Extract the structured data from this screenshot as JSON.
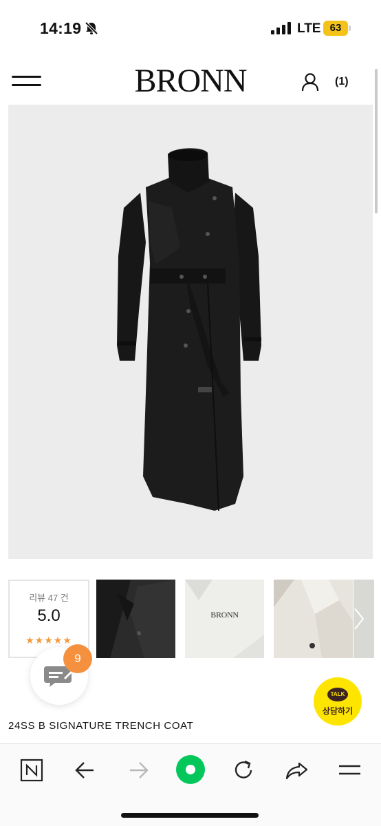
{
  "status_bar": {
    "time": "14:19",
    "network": "LTE",
    "battery": "63",
    "icons": [
      "bell-slash-icon",
      "signal-icon"
    ]
  },
  "header": {
    "brand": "BRONN",
    "cart_count": "(1)",
    "icons": [
      "menu-icon",
      "user-icon"
    ]
  },
  "reviews": {
    "count_label": "리뷰 47 건",
    "score": "5.0",
    "stars": "★★★★★",
    "star_color": "#f29a3c"
  },
  "thumbnails": {
    "brand_text": "BRONN"
  },
  "review_fab": {
    "badge": "9",
    "badge_color": "#f5913e"
  },
  "talk_button": {
    "bubble": "TALK",
    "label": "상담하기",
    "color": "#fde500"
  },
  "product": {
    "title": "24SS B SIGNATURE TRENCH COAT"
  },
  "toolbar": {
    "icons": [
      "naver-n-icon",
      "back-arrow-icon",
      "forward-arrow-icon",
      "green-dot-icon",
      "reload-icon",
      "share-icon",
      "hamburger-icon"
    ],
    "accent": "#03c75a"
  }
}
